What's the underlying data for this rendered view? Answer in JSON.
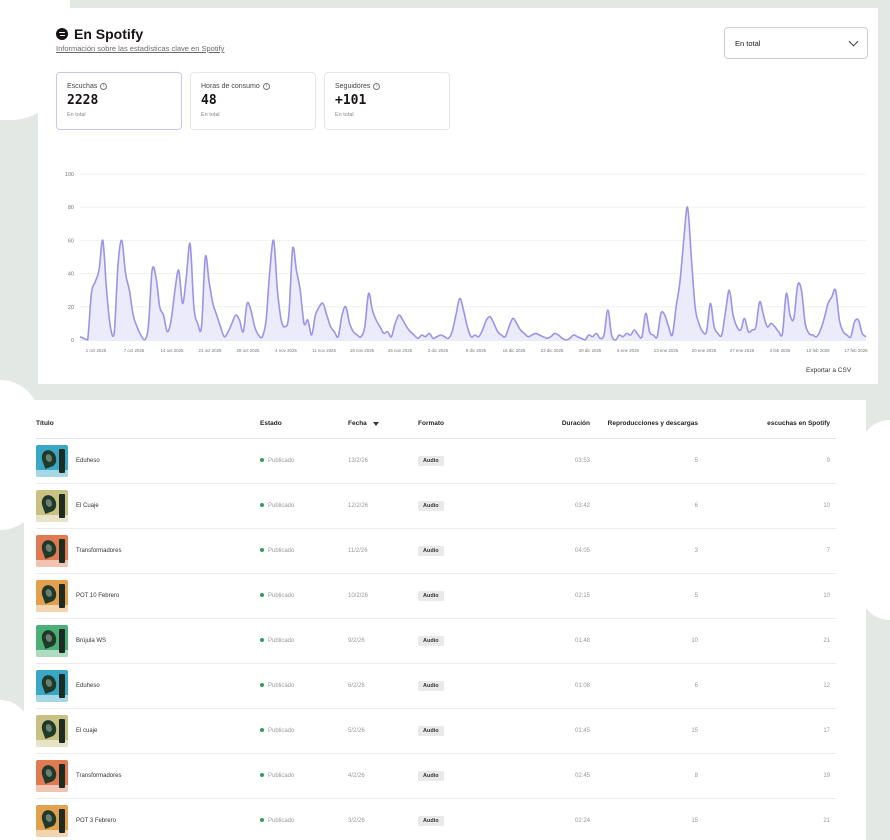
{
  "header": {
    "title": "En Spotify",
    "subtitle": "Información sobre las estadísticas clave en Spotify"
  },
  "period_select": {
    "value": "En total"
  },
  "cards": [
    {
      "label": "Escuchas",
      "value": "2228",
      "note": "En total",
      "active": true
    },
    {
      "label": "Horas de consumo",
      "value": "48",
      "note": "En total",
      "active": false
    },
    {
      "label": "Seguidores",
      "value": "+101",
      "note": "En total",
      "active": false
    }
  ],
  "export_label": "Exportar a CSV",
  "colors": {
    "line": "#9b93ec",
    "fill": "#ecebfb",
    "accent": "#c9c7ef",
    "status": "#2e9e5b"
  },
  "chart_data": {
    "type": "area",
    "yticks": [
      0,
      20,
      40,
      60,
      80,
      100
    ],
    "ylim": [
      0,
      100
    ],
    "xtick_labels": [
      "1 oct 2025",
      "7 oct 2025",
      "14 oct 2025",
      "21 oct 2025",
      "28 oct 2025",
      "4 nov 2025",
      "11 nov 2025",
      "18 nov 2025",
      "25 nov 2025",
      "2 dic 2025",
      "9 dic 2025",
      "16 dic 2025",
      "23 dic 2025",
      "30 dic 2025",
      "6 ene 2026",
      "13 ene 2026",
      "20 ene 2026",
      "27 ene 2026",
      "3 feb 2026",
      "10 feb 2026",
      "17 feb 2026"
    ],
    "series": [
      {
        "values": [
          2,
          1,
          0,
          28,
          35,
          42,
          60,
          30,
          8,
          4,
          45,
          60,
          40,
          30,
          15,
          8,
          3,
          0,
          8,
          42,
          38,
          20,
          15,
          5,
          12,
          30,
          42,
          22,
          38,
          58,
          20,
          10,
          8,
          50,
          35,
          22,
          15,
          8,
          2,
          5,
          10,
          15,
          12,
          5,
          22,
          18,
          8,
          3,
          2,
          12,
          42,
          60,
          30,
          12,
          8,
          15,
          55,
          42,
          30,
          10,
          12,
          3,
          15,
          20,
          22,
          15,
          8,
          5,
          2,
          15,
          20,
          10,
          5,
          3,
          2,
          8,
          28,
          18,
          12,
          8,
          4,
          5,
          2,
          10,
          15,
          12,
          8,
          5,
          3,
          1,
          3,
          2,
          4,
          1,
          2,
          3,
          2,
          1,
          5,
          15,
          25,
          18,
          8,
          2,
          3,
          2,
          6,
          12,
          14,
          10,
          5,
          3,
          2,
          8,
          13,
          10,
          6,
          4,
          2,
          3,
          4,
          3,
          2,
          1,
          2,
          4,
          3,
          1,
          0,
          1,
          3,
          2,
          1,
          0,
          3,
          2,
          4,
          1,
          3,
          18,
          3,
          0,
          3,
          2,
          4,
          3,
          6,
          3,
          2,
          16,
          5,
          3,
          2,
          16,
          15,
          8,
          3,
          20,
          35,
          60,
          80,
          50,
          20,
          10,
          5,
          5,
          22,
          8,
          4,
          3,
          17,
          30,
          15,
          8,
          6,
          13,
          5,
          6,
          8,
          23,
          15,
          8,
          10,
          8,
          5,
          4,
          28,
          15,
          13,
          33,
          30,
          10,
          4,
          3,
          2,
          6,
          13,
          22,
          26,
          30,
          12,
          5,
          3,
          2,
          11,
          12,
          4,
          2
        ]
      }
    ]
  },
  "table": {
    "headers": {
      "title": "Título",
      "status": "Estado",
      "date": "Fecha",
      "format": "Formato",
      "duration": "Duración",
      "plays": "Reproducciones y descargas",
      "spotify": "escuchas en Spotify"
    },
    "rows": [
      {
        "title": "Eduheso",
        "status": "Publicado",
        "date": "13/2/26",
        "format": "Audio",
        "duration": "03:53",
        "plays": "5",
        "spotify": "9",
        "thumb_color": "#3aa7c4"
      },
      {
        "title": "El Cuaje",
        "status": "Publicado",
        "date": "12/2/26",
        "format": "Audio",
        "duration": "03:42",
        "plays": "6",
        "spotify": "10",
        "thumb_color": "#c9c183"
      },
      {
        "title": "Transformadores",
        "status": "Publicado",
        "date": "11/2/26",
        "format": "Audio",
        "duration": "04:05",
        "plays": "3",
        "spotify": "7",
        "thumb_color": "#e07a52"
      },
      {
        "title": "POT 10 Febrero",
        "status": "Publicado",
        "date": "10/2/26",
        "format": "Audio",
        "duration": "02:15",
        "plays": "5",
        "spotify": "10",
        "thumb_color": "#e3a04e"
      },
      {
        "title": "Brújula WS",
        "status": "Publicado",
        "date": "9/2/26",
        "format": "Audio",
        "duration": "01:48",
        "plays": "10",
        "spotify": "21",
        "thumb_color": "#4caf78"
      },
      {
        "title": "Eduheso",
        "status": "Publicado",
        "date": "6/2/26",
        "format": "Audio",
        "duration": "01:08",
        "plays": "6",
        "spotify": "12",
        "thumb_color": "#3aa7c4"
      },
      {
        "title": "El cuaje",
        "status": "Publicado",
        "date": "5/2/26",
        "format": "Audio",
        "duration": "01:45",
        "plays": "15",
        "spotify": "17",
        "thumb_color": "#c9c183"
      },
      {
        "title": "Transformadores",
        "status": "Publicado",
        "date": "4/2/26",
        "format": "Audio",
        "duration": "02:45",
        "plays": "8",
        "spotify": "19",
        "thumb_color": "#e07a52"
      },
      {
        "title": "POT 3 Febrero",
        "status": "Publicado",
        "date": "3/2/26",
        "format": "Audio",
        "duration": "02:24",
        "plays": "15",
        "spotify": "21",
        "thumb_color": "#e3a04e"
      }
    ]
  }
}
